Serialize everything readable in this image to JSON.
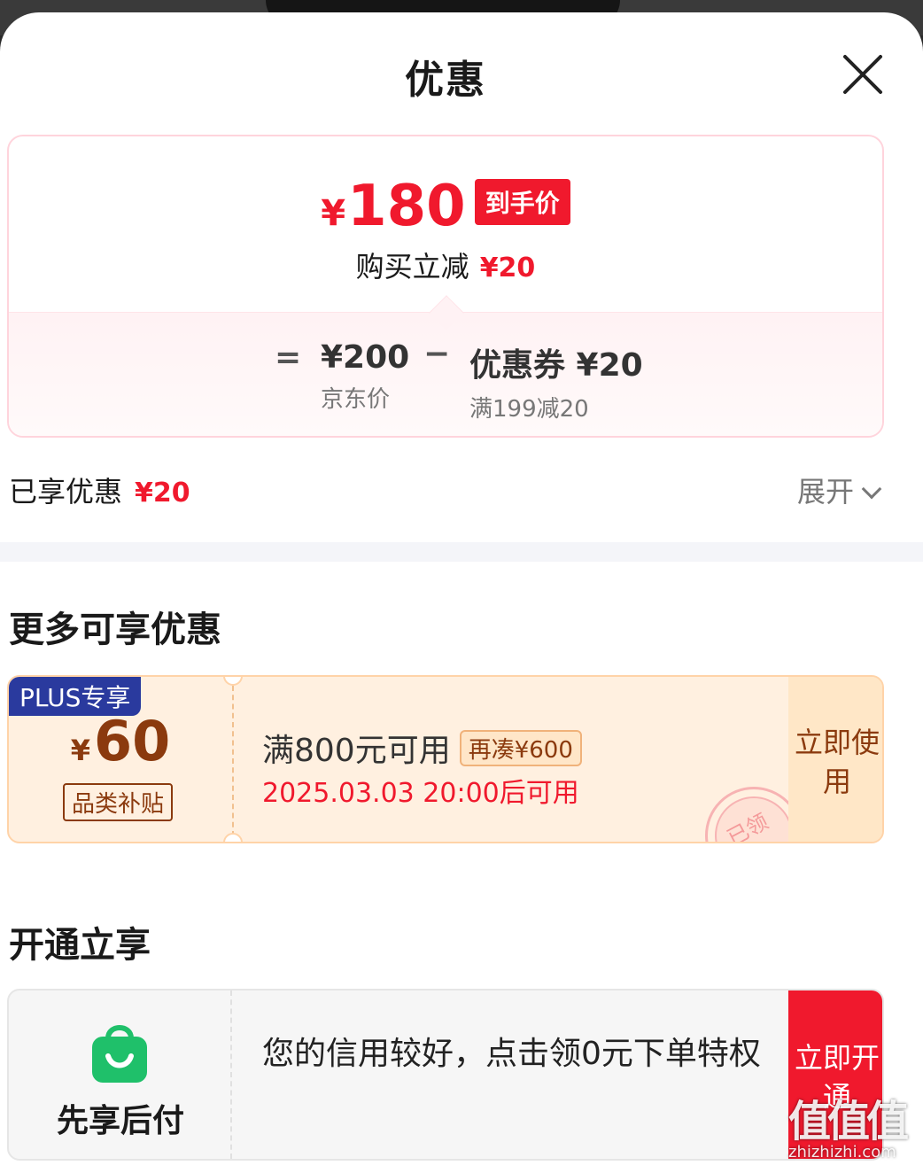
{
  "header": {
    "title": "优惠"
  },
  "price_summary": {
    "currency": "¥",
    "final_price": "180",
    "final_tag": "到手价",
    "discount_label": "购买立减",
    "discount_amount": "¥20",
    "equals": "=",
    "minus": "−",
    "jd_price": "¥200",
    "jd_price_label": "京东价",
    "coupon_value": "优惠券 ¥20",
    "coupon_condition": "满199减20"
  },
  "enjoyed": {
    "label": "已享优惠",
    "amount": "¥20",
    "expand_label": "展开"
  },
  "more_offers": {
    "title": "更多可享优惠",
    "coupon": {
      "badge": "PLUS专享",
      "currency": "¥",
      "amount": "60",
      "category": "品类补贴",
      "condition": "满800元可用",
      "gap": "再凑¥600",
      "valid_time": "2025.03.03 20:00后可用",
      "stamp": "已领",
      "action": "立即使用"
    }
  },
  "open_enjoy": {
    "title": "开通立享",
    "card": {
      "name": "先享后付",
      "description": "您的信用较好，点击领0元下单特权",
      "action": "立即开通"
    }
  },
  "watermark": {
    "text": "值值值",
    "domain": "zhizhizhi.com"
  },
  "colors": {
    "accent_red": "#f0192d",
    "coupon_brown": "#8b3a0e",
    "plus_blue": "#2a3a9e",
    "pay_green": "#1fc06a"
  },
  "icons": [
    "close-icon",
    "chevron-down-icon",
    "shopping-bag-icon"
  ]
}
